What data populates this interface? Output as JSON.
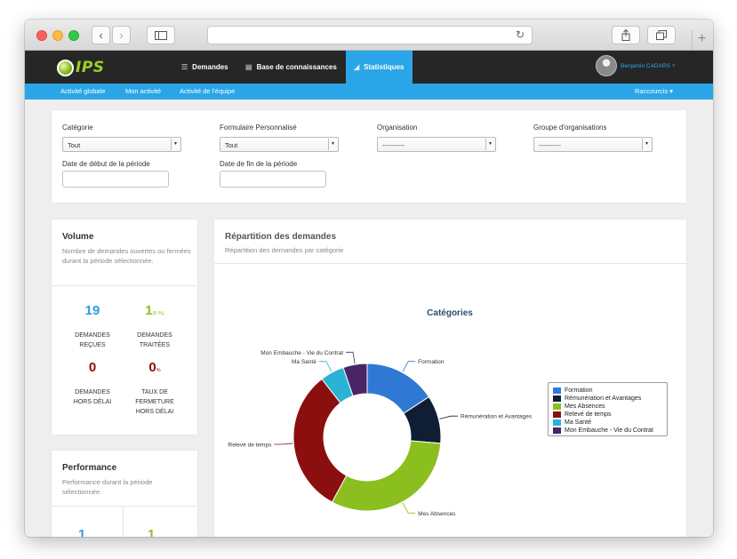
{
  "nav": {
    "logo_text": "IPS",
    "items": [
      {
        "label": "Demandes",
        "icon": "list-icon"
      },
      {
        "label": "Base de connaissances",
        "icon": "book-icon"
      },
      {
        "label": "Statistiques",
        "icon": "chart-icon"
      }
    ],
    "user_name": "Benjamin CADARS ˅"
  },
  "subnav": {
    "items": [
      "Activité globale",
      "Mon activité",
      "Activité de l'équipe"
    ],
    "shortcuts": "Raccourcis ▾"
  },
  "filters": {
    "categorie_label": "Catégorie",
    "categorie_value": "Tout",
    "formulaire_label": "Formulaire Personnalisé",
    "formulaire_value": "Tout",
    "organisation_label": "Organisation",
    "organisation_value": "----------",
    "groupe_label": "Groupe d'organisations",
    "groupe_value": "----------",
    "date_debut_label": "Date de début de la période",
    "date_fin_label": "Date de fin de la période"
  },
  "volume": {
    "title": "Volume",
    "description": "Nombre de demandes ouvertes ou fermées durant la période sélectionnée.",
    "recues_num": "19",
    "recues_label_1": "DEMANDES",
    "recues_label_2": "REÇUES",
    "traitees_num": "1",
    "traitees_pct": "(5 %)",
    "traitees_label_1": "DEMANDES",
    "traitees_label_2": "TRAITÉES",
    "hors_delai_num": "0",
    "hors_delai_label_1": "DEMANDES",
    "hors_delai_label_2": "HORS DÉLAI",
    "taux_num": "0",
    "taux_pct": "%",
    "taux_label_1": "TAUX DE",
    "taux_label_2": "FERMETURE",
    "taux_label_3": "HORS DÉLAI",
    "colors": {
      "blue": "#2b9fe0",
      "green": "#8bbf1f",
      "darkred": "#8b0f0f"
    }
  },
  "performance": {
    "title": "Performance",
    "description": "Performance durant la période sélectionnée.",
    "val_left": "1",
    "val_right": "1"
  },
  "repartition": {
    "title": "Répartition des demandes",
    "description": "Répartition des demandes par catégorie"
  },
  "chart_data": {
    "type": "pie",
    "title": "Catégories",
    "categories": [
      "Formation",
      "Rémunération et Avantages",
      "Mes Absences",
      "Relevé de temps",
      "Ma Santé",
      "Mon Embauche - Vie du Contrat"
    ],
    "values": [
      3,
      2,
      6,
      6,
      1,
      1
    ],
    "colors": [
      "#2f79d4",
      "#0f1e33",
      "#8bbf1f",
      "#8b0f0f",
      "#2bb3d6",
      "#4a2466"
    ],
    "legend_position": "right"
  }
}
